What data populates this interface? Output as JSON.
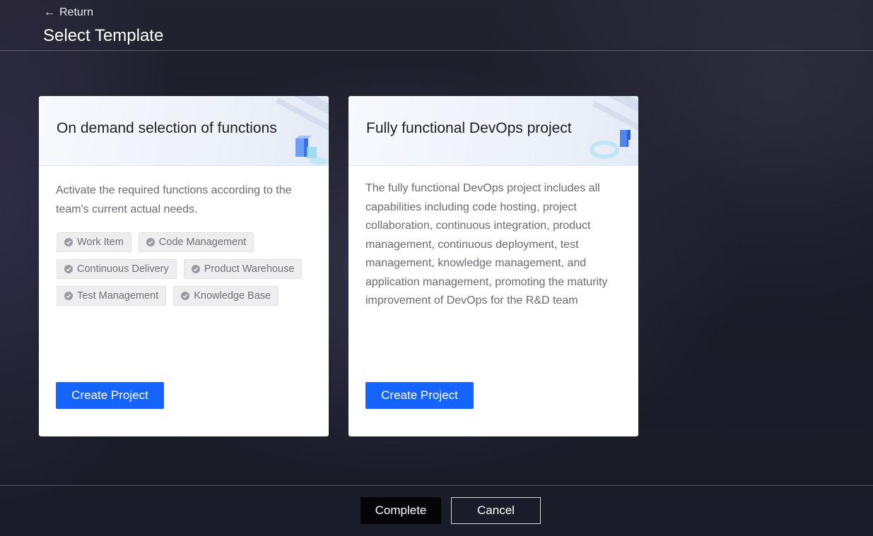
{
  "header": {
    "return_label": "Return",
    "title": "Select Template"
  },
  "cards": [
    {
      "title": "On demand selection of functions",
      "description": "Activate the required functions according to the team's current actual needs.",
      "tags": [
        "Work Item",
        "Code Management",
        "Continuous Delivery",
        "Product Warehouse",
        "Test Management",
        "Knowledge Base"
      ],
      "button_label": "Create Project"
    },
    {
      "title": "Fully functional DevOps project",
      "description": "The fully functional DevOps project includes all capabilities including code hosting, project collaboration, continuous integration, product management, continuous deployment, test management, knowledge management, and application management, promoting the maturity improvement of DevOps for the R&D team",
      "button_label": "Create Project"
    }
  ],
  "footer": {
    "complete_label": "Complete",
    "cancel_label": "Cancel"
  },
  "colors": {
    "primary": "#1664ff",
    "background": "#1b1c29",
    "card": "#ffffff",
    "tag_bg": "#eeeef0"
  },
  "icons": {
    "return": "arrow-left-icon",
    "tag": "check-circle-icon"
  }
}
